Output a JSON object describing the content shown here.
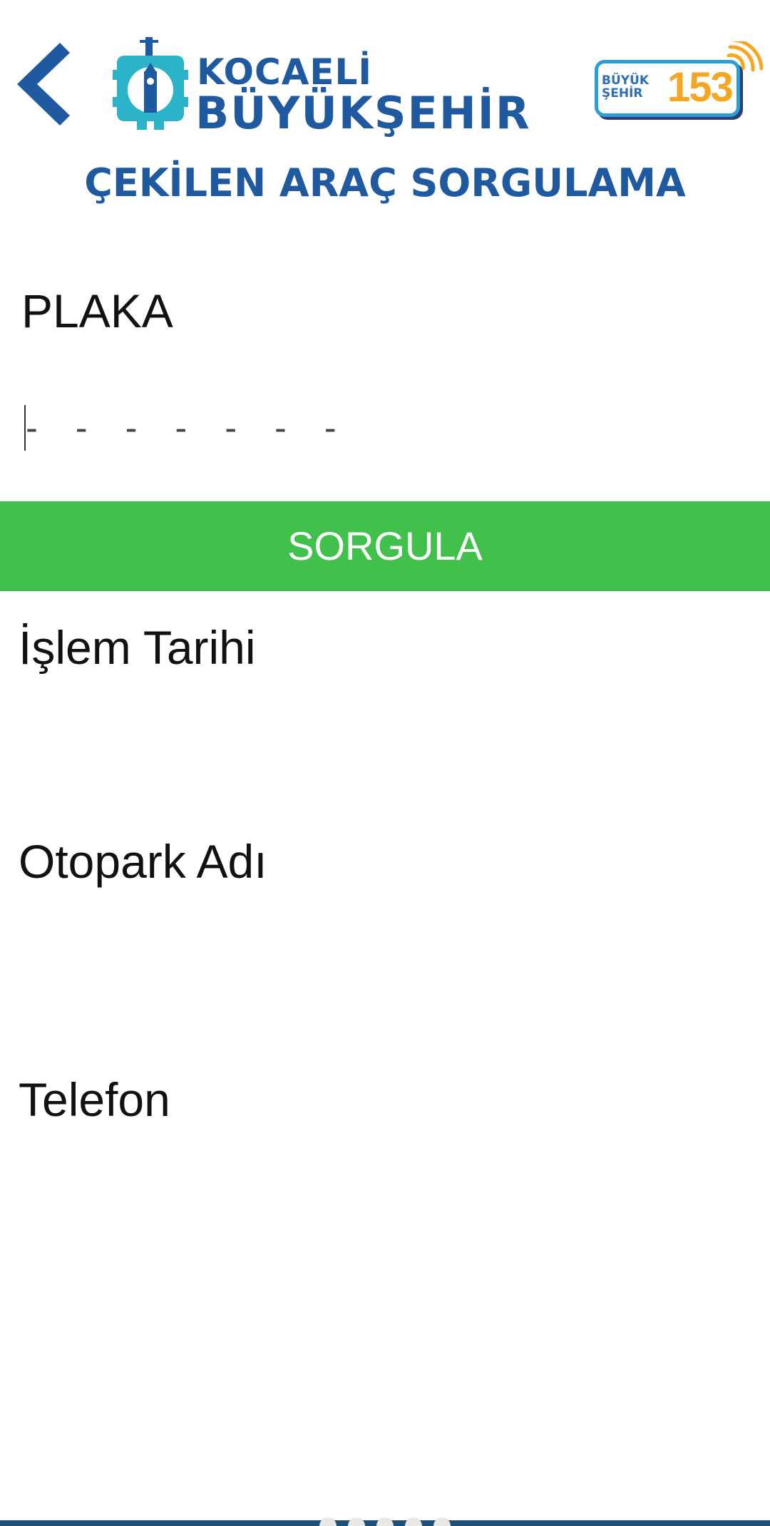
{
  "header": {
    "back_icon": "chevron-left-icon",
    "logo": {
      "line1": "KOCAELİ",
      "line2": "BÜYÜKŞEHİR",
      "emblem_icon": "city-emblem-icon"
    },
    "badge": {
      "small_line1": "BÜYÜK",
      "small_line2": "ŞEHİR",
      "number": "153",
      "wave_icon": "signal-wave-icon"
    }
  },
  "page": {
    "title": "ÇEKİLEN ARAÇ SORGULAMA"
  },
  "form": {
    "plate_label": "PLAKA",
    "plate_value": "",
    "plate_placeholder": "- - - - - - -",
    "submit_label": "SORGULA"
  },
  "results": {
    "fields": [
      {
        "label": "İşlem Tarihi",
        "value": ""
      },
      {
        "label": "Otopark Adı",
        "value": ""
      },
      {
        "label": "Telefon",
        "value": ""
      }
    ]
  },
  "colors": {
    "brand_blue": "#1f5aa0",
    "accent_green": "#41c04b",
    "badge_orange": "#f5a623",
    "badge_cyan": "#2a9fd6",
    "footer_navy": "#1d4f7a"
  }
}
